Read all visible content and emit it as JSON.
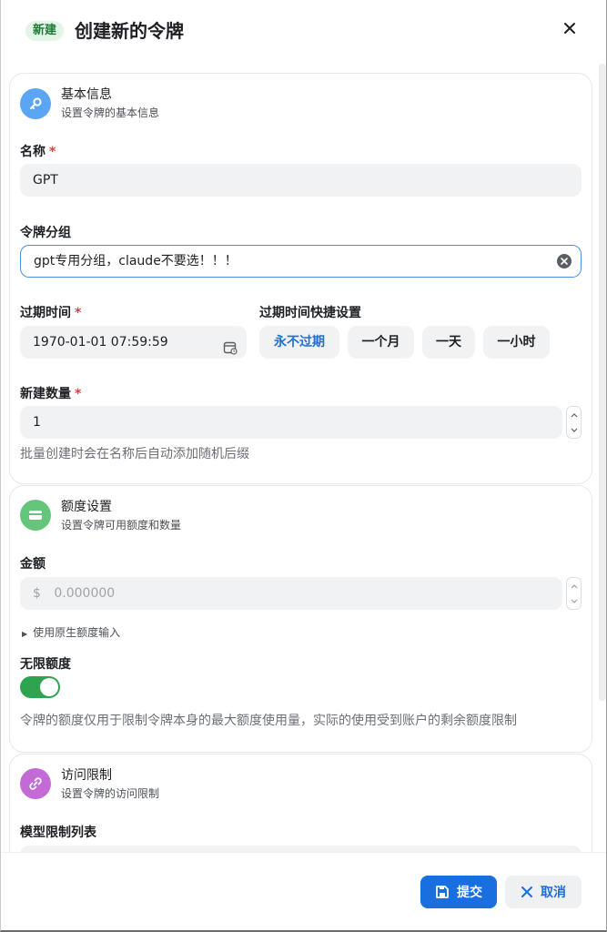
{
  "header": {
    "badge": "新建",
    "title": "创建新的令牌",
    "close_icon": "close-icon"
  },
  "basic": {
    "title": "基本信息",
    "subtitle": "设置令牌的基本信息",
    "icon": "key-icon",
    "icon_color": "#5aa6f5",
    "name_label": "名称",
    "name_value": "GPT",
    "group_label": "令牌分组",
    "group_value": "gpt专用分组，claude不要选！！！",
    "expire_label": "过期时间",
    "expire_value": "1970-01-01 07:59:59",
    "quick_label": "过期时间快捷设置",
    "quick_options": [
      "永不过期",
      "一个月",
      "一天",
      "一小时"
    ],
    "quick_selected": "永不过期",
    "count_label": "新建数量",
    "count_value": "1",
    "count_hint": "批量创建时会在名称后自动添加随机后缀"
  },
  "quota": {
    "title": "额度设置",
    "subtitle": "设置令牌可用额度和数量",
    "icon": "card-icon",
    "icon_color": "#64c67a",
    "amount_label": "金额",
    "amount_prefix": "$",
    "amount_placeholder": "0.000000",
    "raw_toggle": "使用原生额度输入",
    "unlimited_label": "无限额度",
    "unlimited_on": true,
    "hint": "令牌的额度仅用于限制令牌本身的最大额度使用量，实际的使用受到账户的剩余额度限制"
  },
  "access": {
    "title": "访问限制",
    "subtitle": "设置令牌的访问限制",
    "icon": "link-icon",
    "icon_color": "#c46ad6",
    "model_label": "模型限制列表"
  },
  "footer": {
    "submit": "提交",
    "cancel": "取消"
  },
  "colors": {
    "primary": "#1a6fe0",
    "toggle_on": "#2ea44f",
    "required": "#e0393e"
  }
}
